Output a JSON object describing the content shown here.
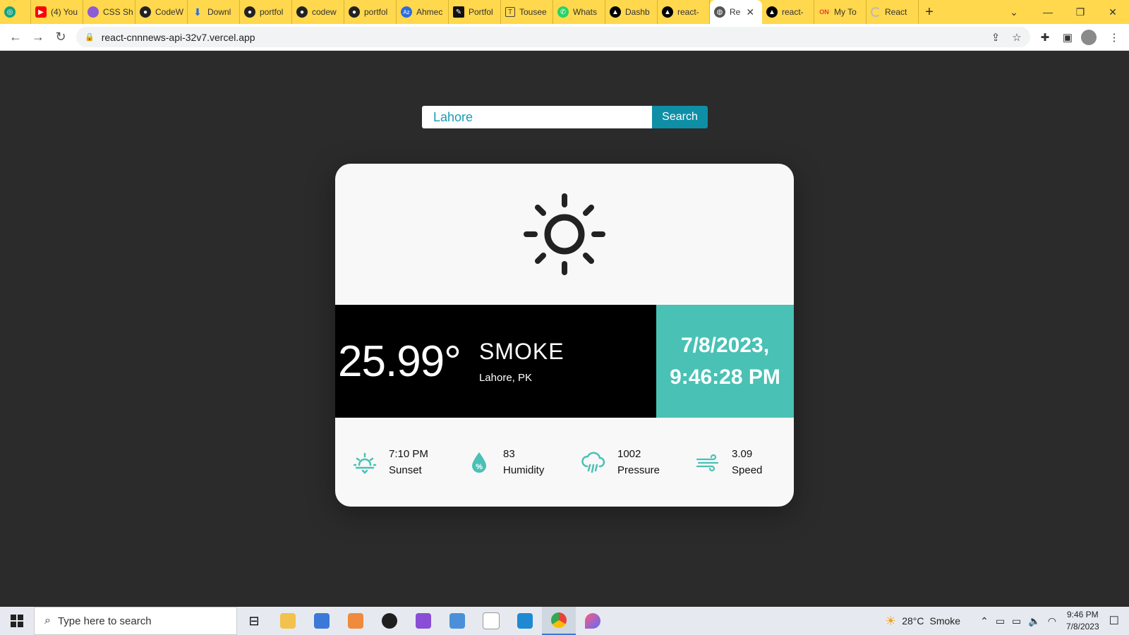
{
  "browser": {
    "tabs": [
      {
        "label": "",
        "favicon": "chatgpt-icon",
        "color": "#10a37f"
      },
      {
        "label": "(4) You",
        "favicon": "youtube-icon",
        "color": "#ff0000"
      },
      {
        "label": "CSS Sh",
        "favicon": "avatar-icon",
        "color": "#8a5cd6"
      },
      {
        "label": "CodeW",
        "favicon": "github-icon",
        "color": "#222222"
      },
      {
        "label": "Downl",
        "favicon": "download-icon",
        "color": "#1a73e8"
      },
      {
        "label": "portfol",
        "favicon": "github-icon",
        "color": "#222222"
      },
      {
        "label": "codew",
        "favicon": "github-icon",
        "color": "#222222"
      },
      {
        "label": "portfol",
        "favicon": "github-icon",
        "color": "#222222"
      },
      {
        "label": "Ahmec",
        "favicon": "az-icon",
        "color": "#2d6cdf"
      },
      {
        "label": "Portfol",
        "favicon": "pen-icon",
        "color": "#111111"
      },
      {
        "label": "Tousee",
        "favicon": "text-icon",
        "color": "#444444"
      },
      {
        "label": "Whats",
        "favicon": "whatsapp-icon",
        "color": "#25d366"
      },
      {
        "label": "Dashb",
        "favicon": "vercel-icon",
        "color": "#000000"
      },
      {
        "label": "react-",
        "favicon": "vercel-icon",
        "color": "#000000"
      }
    ],
    "active_tab": {
      "label": "Re",
      "favicon": "globe-icon",
      "color": "#555555"
    },
    "tabs_after": [
      {
        "label": "react-",
        "favicon": "vercel-icon",
        "color": "#000000"
      },
      {
        "label": "My To",
        "favicon": "on-icon",
        "color": "#e53935"
      },
      {
        "label": "React",
        "favicon": "loading-icon",
        "color": "#bbbbbb"
      }
    ],
    "url": "react-cnnnews-api-32v7.vercel.app"
  },
  "search": {
    "value": "Lahore",
    "button_label": "Search"
  },
  "weather": {
    "icon": "sun-icon",
    "temperature": "25.99°",
    "condition": "SMOKE",
    "location": "Lahore, PK",
    "date": "7/8/2023,",
    "time": "9:46:28 PM",
    "stats": [
      {
        "icon": "sunset-icon",
        "value": "7:10 PM",
        "label": "Sunset"
      },
      {
        "icon": "humidity-icon",
        "value": "83",
        "label": "Humidity"
      },
      {
        "icon": "pressure-icon",
        "value": "1002",
        "label": "Pressure"
      },
      {
        "icon": "wind-icon",
        "value": "3.09",
        "label": "Speed"
      }
    ],
    "colors": {
      "accent": "#49c1b5",
      "button": "#0e8fa6",
      "background": "#2b2b2b"
    }
  },
  "taskbar": {
    "search_placeholder": "Type here to search",
    "weather_temp": "28°C",
    "weather_label": "Smoke",
    "clock_time": "9:46 PM",
    "clock_date": "7/8/2023"
  }
}
